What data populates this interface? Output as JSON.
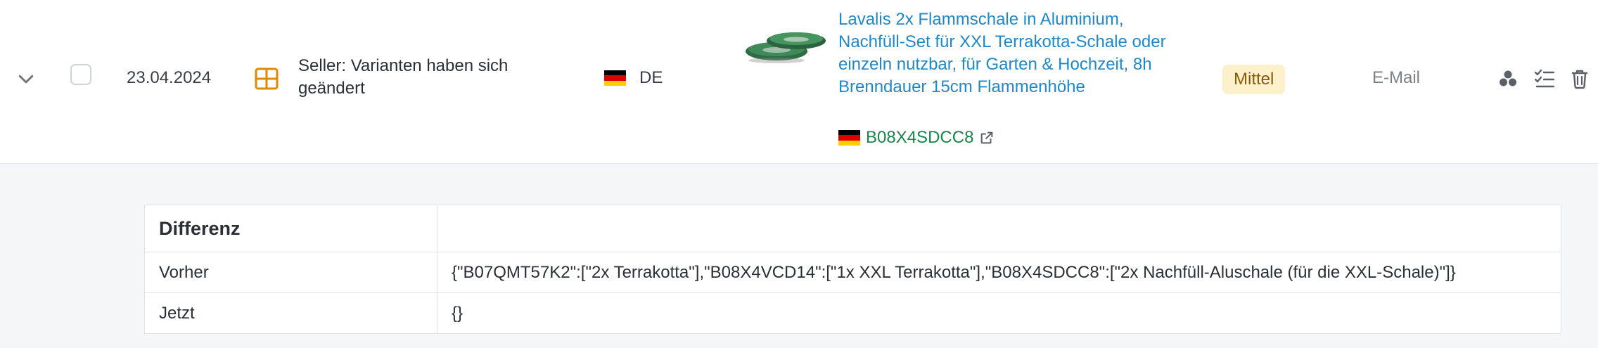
{
  "row": {
    "date": "23.04.2024",
    "event": "Seller: Varianten haben sich geändert",
    "marketplace": "DE",
    "product": {
      "title": "Lavalis 2x Flammschale in Aluminium, Nachfüll-Set für XXL Terrakotta-Schale oder einzeln nutzbar, für Garten & Hochzeit, 8h Brenndauer 15cm Flammenhöhe",
      "asin": "B08X4SDCC8"
    },
    "priority": "Mittel",
    "channel": "E-Mail"
  },
  "diff": {
    "header": "Differenz",
    "header_value": "",
    "rows": [
      {
        "label": "Vorher",
        "value": "{\"B07QMT57K2\":[\"2x Terrakotta\"],\"B08X4VCD14\":[\"1x XXL Terrakotta\"],\"B08X4SDCC8\":[\"2x Nachfüll-Aluschale (für die XXL-Schale)\"]}"
      },
      {
        "label": "Jetzt",
        "value": "{}"
      }
    ]
  },
  "colors": {
    "link": "#1e88c8",
    "asin": "#18864a",
    "badge_bg": "#fdf1cc",
    "badge_text": "#8a5a07",
    "event_icon": "#e08a00"
  },
  "icons": [
    "chevron-down-icon",
    "table-grid-icon",
    "flag-de-icon",
    "external-link-icon",
    "cluster-icon",
    "checklist-icon",
    "trash-icon"
  ]
}
